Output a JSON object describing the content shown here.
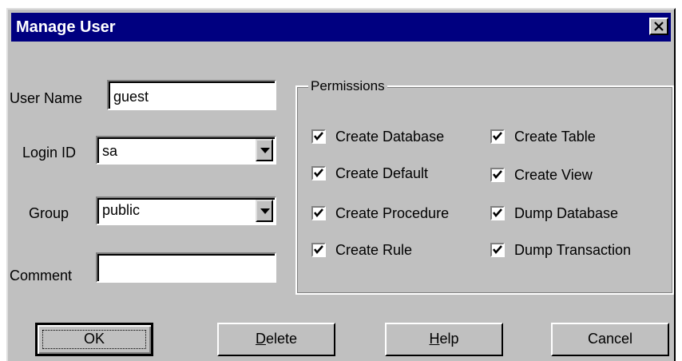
{
  "window": {
    "title": "Manage User",
    "close_label": "×"
  },
  "form": {
    "user_name_label": "User Name",
    "user_name_value": "guest",
    "login_id_label": "Login ID",
    "login_id_value": "sa",
    "group_label": "Group",
    "group_value": "public",
    "comment_label": "Comment",
    "comment_value": ""
  },
  "permissions": {
    "title": "Permissions",
    "items": [
      {
        "label": "Create Database",
        "checked": true
      },
      {
        "label": "Create Table",
        "checked": true
      },
      {
        "label": "Create Default",
        "checked": true
      },
      {
        "label": "Create View",
        "checked": true
      },
      {
        "label": "Create Procedure",
        "checked": true
      },
      {
        "label": "Dump Database",
        "checked": true
      },
      {
        "label": "Create Rule",
        "checked": true
      },
      {
        "label": "Dump Transaction",
        "checked": true
      }
    ]
  },
  "buttons": {
    "ok": "OK",
    "delete_mnemonic": "D",
    "delete_rest": "elete",
    "help_mnemonic": "H",
    "help_rest": "elp",
    "cancel": "Cancel"
  },
  "colors": {
    "titlebar": "#000080",
    "face": "#c0c0c0"
  }
}
